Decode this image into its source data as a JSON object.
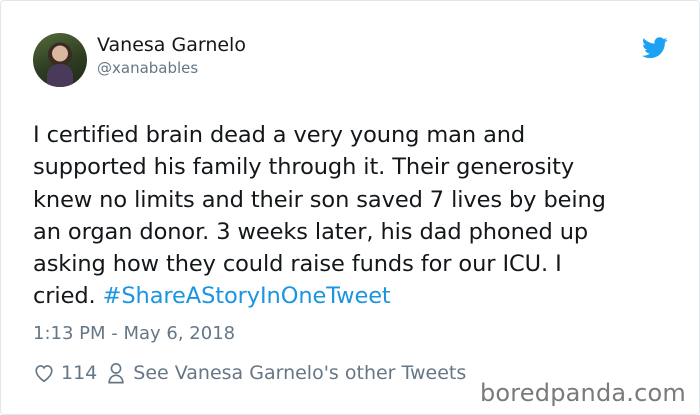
{
  "author": {
    "name": "Vanesa Garnelo",
    "handle": "@xanabables"
  },
  "tweet": {
    "text": "I certified brain dead a very young man and\nsupported his family through it. Their generosity\nknew no limits and their son saved 7 lives by being\nan organ donor. 3 weeks later, his dad phoned up\nasking how they could raise funds for our ICU. I\ncried.  ",
    "hashtag": "#ShareAStoryInOneTweet",
    "timestamp": "1:13 PM - May 6, 2018"
  },
  "actions": {
    "likes": "114",
    "other_tweets_label": "See Vanesa Garnelo's other Tweets"
  },
  "watermark": "boredpanda.com",
  "colors": {
    "link": "#1b95e0",
    "muted": "#657786",
    "text": "#14171a",
    "brand_twitter": "#1da1f2"
  },
  "icons": [
    "avatar-photo",
    "twitter-bird-icon",
    "heart-icon",
    "person-icon"
  ]
}
